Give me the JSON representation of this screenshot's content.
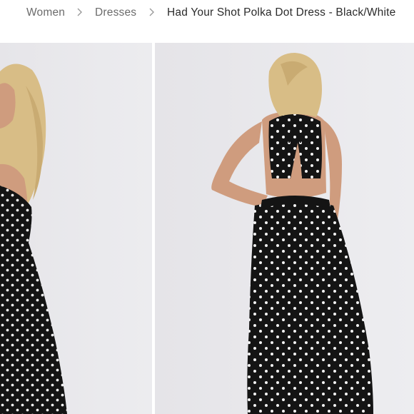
{
  "breadcrumb": {
    "items": [
      {
        "label": "Women"
      },
      {
        "label": "Dresses"
      },
      {
        "label": "Had Your Shot Polka Dot Dress - Black/White"
      }
    ],
    "separator_icon": "chevron-right-icon"
  },
  "gallery": {
    "images": [
      {
        "name": "product-photo-side-view"
      },
      {
        "name": "product-photo-back-view"
      }
    ]
  },
  "colors": {
    "breadcrumb_link": "#6b6b6b",
    "breadcrumb_current": "#2b2b2b",
    "photo_background": "#e9e8ec",
    "dress": "#141414",
    "dots": "#f4f4f4",
    "hair": "#d8bd86",
    "skin": "#cf9c7e"
  }
}
